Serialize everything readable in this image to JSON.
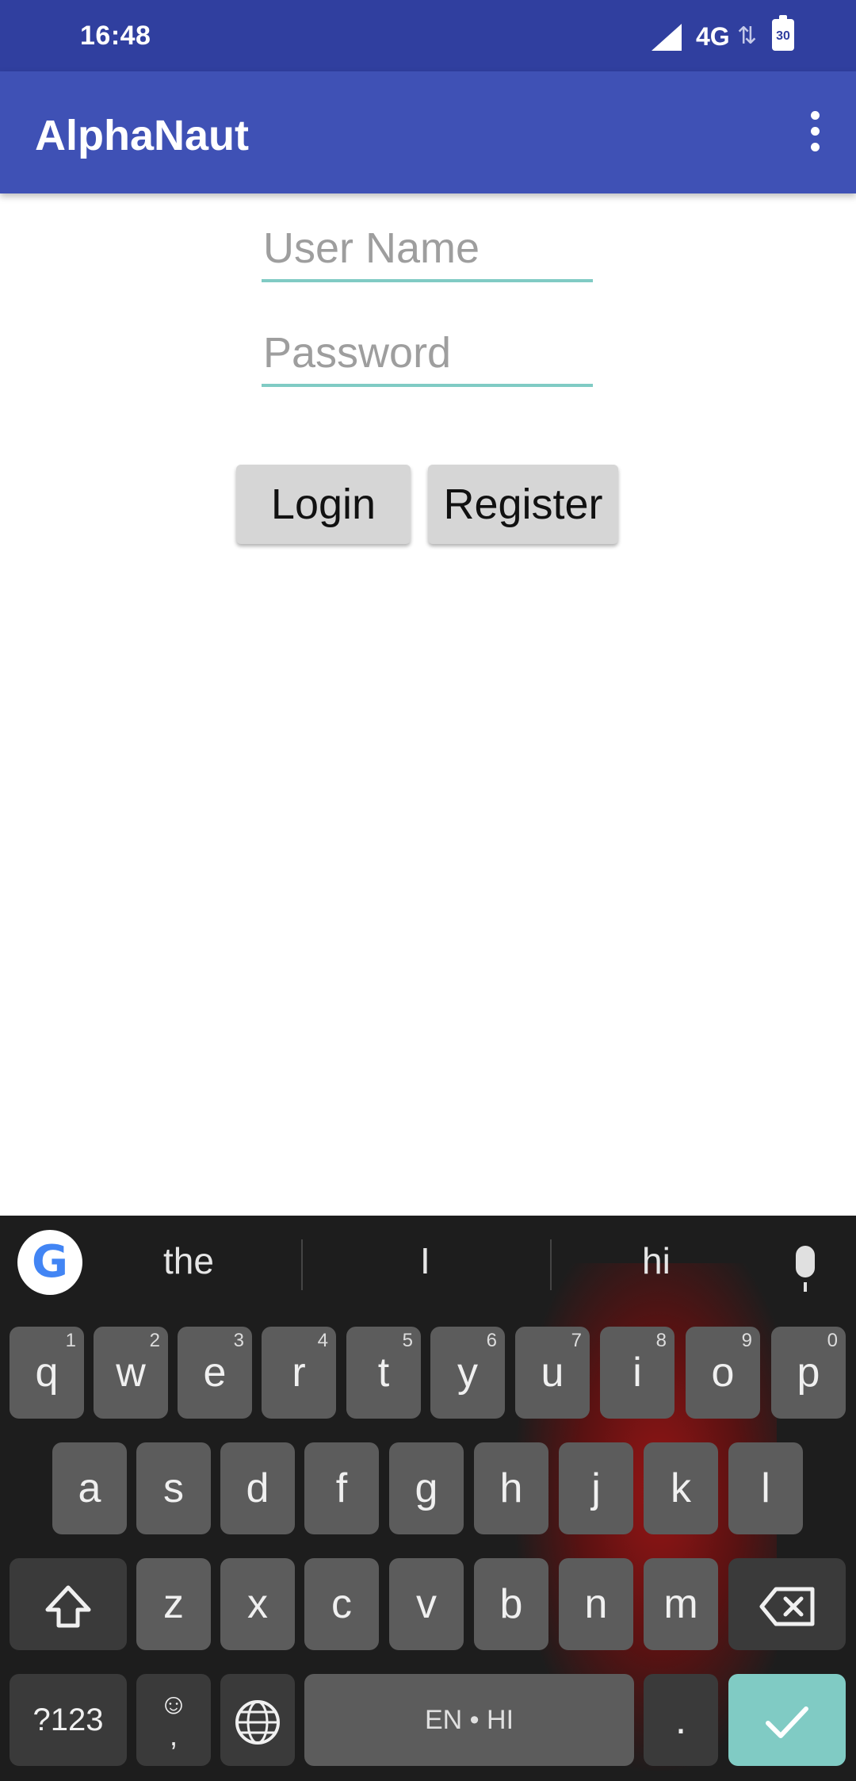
{
  "status_bar": {
    "time": "16:48",
    "network": "4G",
    "battery": "30"
  },
  "app_bar": {
    "title": "AlphaNaut"
  },
  "form": {
    "username_placeholder": "User Name",
    "password_placeholder": "Password",
    "login_label": "Login",
    "register_label": "Register"
  },
  "keyboard": {
    "suggestions": [
      "the",
      "I",
      "hi"
    ],
    "row1": [
      {
        "k": "q",
        "h": "1"
      },
      {
        "k": "w",
        "h": "2"
      },
      {
        "k": "e",
        "h": "3"
      },
      {
        "k": "r",
        "h": "4"
      },
      {
        "k": "t",
        "h": "5"
      },
      {
        "k": "y",
        "h": "6"
      },
      {
        "k": "u",
        "h": "7"
      },
      {
        "k": "i",
        "h": "8"
      },
      {
        "k": "o",
        "h": "9"
      },
      {
        "k": "p",
        "h": "0"
      }
    ],
    "row2": [
      "a",
      "s",
      "d",
      "f",
      "g",
      "h",
      "j",
      "k",
      "l"
    ],
    "row3": [
      "z",
      "x",
      "c",
      "v",
      "b",
      "n",
      "m"
    ],
    "symbols_label": "?123",
    "emoji_label": "☺",
    "comma_label": ",",
    "space_label": "EN • HI",
    "period_label": "."
  }
}
